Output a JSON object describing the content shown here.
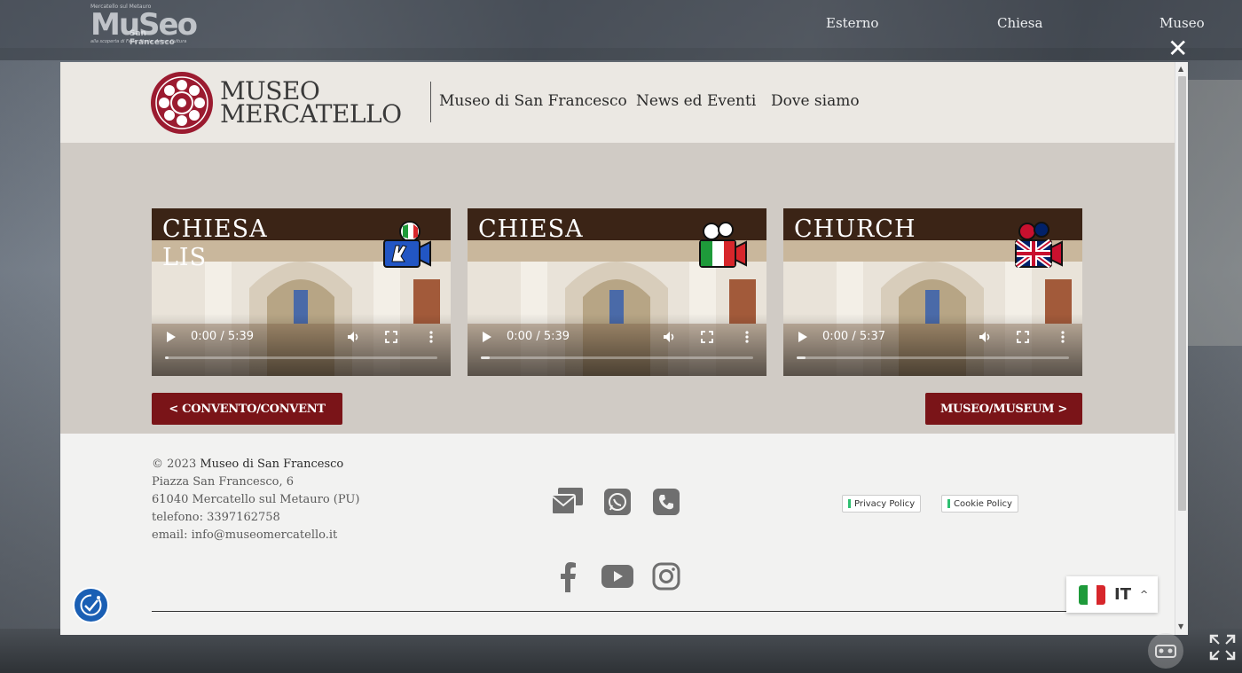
{
  "tour": {
    "logo": {
      "top_text": "Mercatello sul Metauro",
      "main_text": "MuSeo",
      "sub_text": "San Francesco",
      "tagline": "alla scoperta di Fede, Storia, Arte e Cultura"
    },
    "nav": [
      "Esterno",
      "Chiesa",
      "Museo"
    ],
    "close_symbol": "✕"
  },
  "site": {
    "logo_line1": "MUSEO",
    "logo_line2": "MERCATELLO",
    "nav": [
      "Museo di San Francesco",
      "News ed Eventi",
      "Dove siamo"
    ]
  },
  "videos": [
    {
      "title_line1": "CHIESA",
      "title_line2": "LIS",
      "time": "0:00 / 5:39",
      "icon": "sign-language-camera-icon",
      "flag": "italy"
    },
    {
      "title_line1": "CHIESA",
      "title_line2": "",
      "time": "0:00 / 5:39",
      "icon": "video-camera-italy-icon",
      "flag": "italy"
    },
    {
      "title_line1": "CHURCH",
      "title_line2": "",
      "time": "0:00 / 5:37",
      "icon": "video-camera-uk-icon",
      "flag": "uk"
    }
  ],
  "buttons": {
    "prev": "< CONVENTO/CONVENT",
    "next": "MUSEO/MUSEUM >"
  },
  "footer": {
    "copyright_prefix": "© 2023",
    "brand": "Museo di San Francesco",
    "address1": "Piazza San Francesco, 6",
    "address2": "61040 Mercatello sul Metauro (PU)",
    "phone": "telefono: 3397162758",
    "email": "email: info@museomercatello.it",
    "privacy": "Privacy Policy",
    "cookie": "Cookie Policy"
  },
  "language": {
    "code": "IT",
    "caret": "^"
  },
  "colors": {
    "brand_red": "#7a1418",
    "logo_rose": "#9b1b30",
    "header_bg": "#ebe8e3",
    "content_bg": "#d0cbc5",
    "footer_bg": "#f2f2f1",
    "a11y_blue": "#1a5fb4"
  }
}
